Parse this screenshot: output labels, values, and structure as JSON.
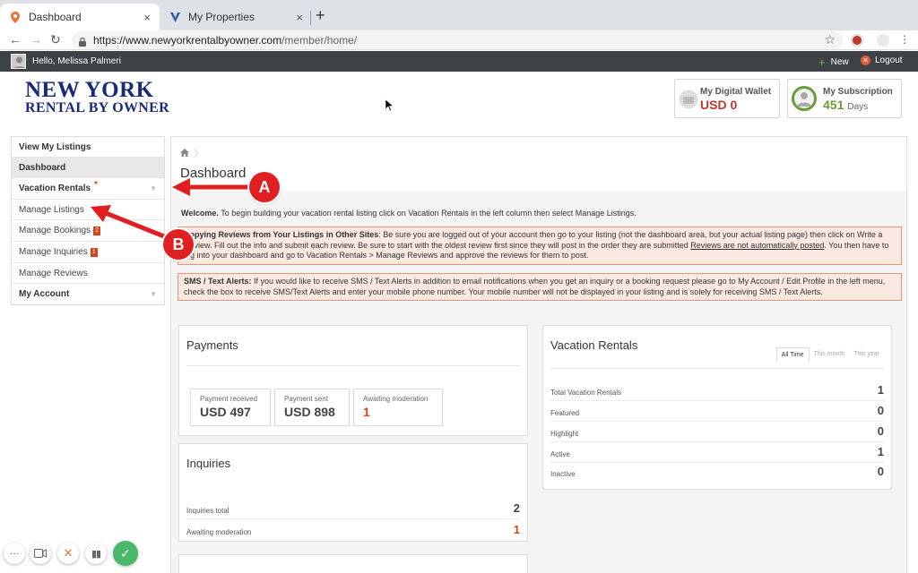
{
  "browser": {
    "tabs": [
      {
        "title": "Dashboard",
        "close": "×"
      },
      {
        "title": "My Properties",
        "close": "×"
      }
    ],
    "new_tab": "+",
    "nav": {
      "back": "←",
      "forward": "→",
      "reload": "↻"
    },
    "url_host": "https://www.newyorkrentalbyowner.com",
    "url_path": "/member/home/",
    "star": "☆"
  },
  "topbar": {
    "greeting": "Hello, Melissa Palmeri",
    "new_label": "New",
    "logout_label": "Logout"
  },
  "logo": {
    "line1": "NEW YORK",
    "line2": "RENTAL BY OWNER"
  },
  "wallet": {
    "title": "My Digital Wallet",
    "value": "USD 0"
  },
  "subscription": {
    "title": "My Subscription",
    "value": "451",
    "unit": "Days"
  },
  "sidebar": {
    "items": [
      {
        "label": "View My Listings"
      },
      {
        "label": "Dashboard"
      },
      {
        "label": "Vacation Rentals",
        "marker": "*"
      },
      {
        "label": "Manage Listings"
      },
      {
        "label": "Manage Bookings",
        "badge": "2"
      },
      {
        "label": "Manage Inquiries",
        "badge": "1"
      },
      {
        "label": "Manage Reviews"
      },
      {
        "label": "My Account"
      }
    ]
  },
  "main": {
    "title": "Dashboard",
    "welcome_bold": "Welcome.",
    "welcome_text": " To begin building your vacation rental listing click on Vacation Rentals in the left column then select Manage Listings.",
    "notice1_bold": "Copying Reviews from Your Listings in Other Sites",
    "notice1_text": ": Be sure you are logged out of your account then go to your listing (not the dashboard area, but your actual listing page) then click on Write a Review. Fill out the info and submit each review. Be sure to start with the oldest review first since they will post in the order they are submitted ",
    "notice1_underline": "Reviews are not automatically posted",
    "notice1_text2": ". You then have to log into your dashboard and go to Vacation Rentals > Manage Reviews and approve the reviews for them to post.",
    "notice2_bold": "SMS / Text Alerts:",
    "notice2_text": " If you would like to receive SMS / Text Alerts in addition to email notifications when you get an inquiry or a booking request please go to My Account / Edit Profile in the left menu, check the box to receive SMS/Text Alerts and enter your mobile phone number. Your mobile number will not be displayed in your listing and is solely for receiving SMS / Text Alerts."
  },
  "payments": {
    "title": "Payments",
    "boxes": [
      {
        "label": "Payment received",
        "value": "USD 497"
      },
      {
        "label": "Payment sent",
        "value": "USD 898"
      },
      {
        "label": "Awaiting moderation",
        "value": "1"
      }
    ]
  },
  "inquiries": {
    "title": "Inquiries",
    "rows": [
      {
        "label": "Inquiries total",
        "value": "2"
      },
      {
        "label": "Awaiting moderation",
        "value": "1"
      }
    ]
  },
  "rentals": {
    "title": "Vacation Rentals",
    "tabs": [
      "All Time",
      "This month",
      "This year"
    ],
    "rows": [
      {
        "label": "Total Vacation Rentals",
        "value": "1"
      },
      {
        "label": "Featured",
        "value": "0"
      },
      {
        "label": "Highlight",
        "value": "0"
      },
      {
        "label": "Active",
        "value": "1"
      },
      {
        "label": "Inactive",
        "value": "0"
      }
    ]
  },
  "annotations": {
    "a": "A",
    "b": "B"
  },
  "colors": {
    "accent_orange": "#d9431c",
    "wallet_red": "#c0392b",
    "subscription_green": "#6a9a3a",
    "callout_red": "#e02020"
  }
}
